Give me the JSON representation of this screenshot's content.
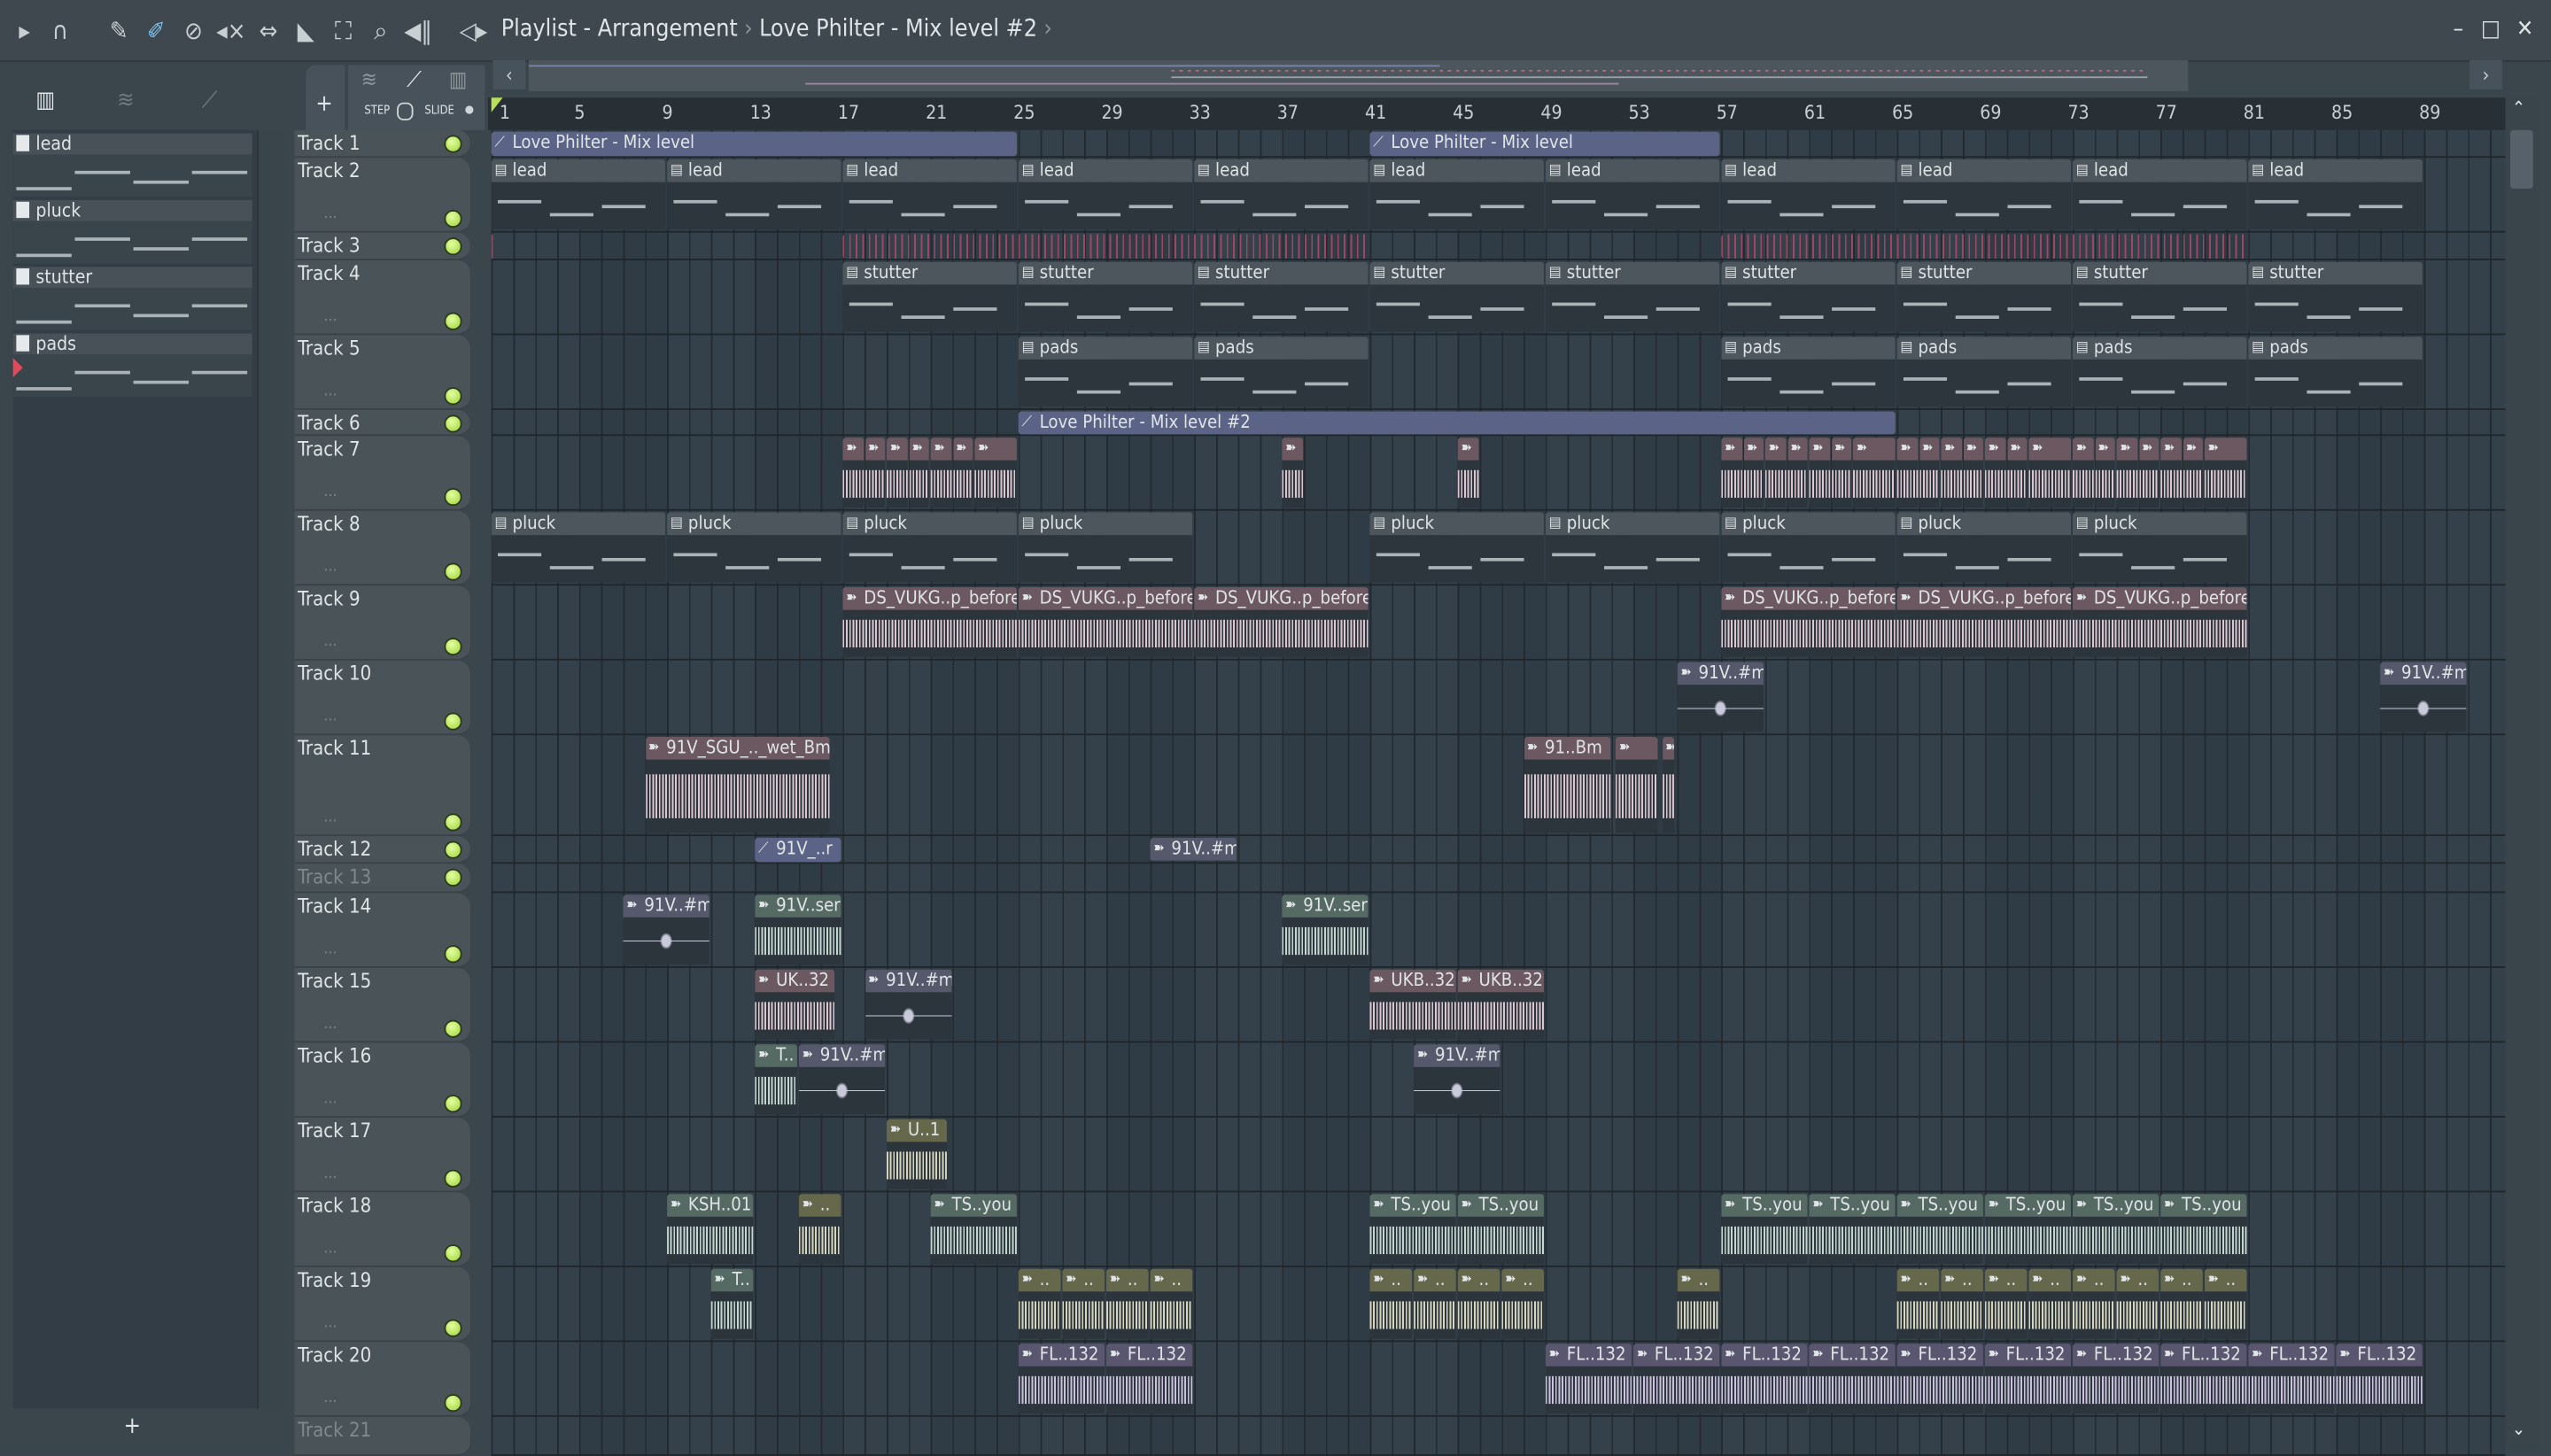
{
  "topbar": {
    "icons": [
      "play-arrow-icon",
      "magnet-icon",
      "pencil-icon",
      "paint-brush-icon",
      "delete-icon",
      "mute-icon",
      "slip-icon",
      "select-icon",
      "zoom-select-icon",
      "zoom-icon",
      "playback-icon",
      "speaker-icon"
    ],
    "breadcrumb": [
      "Playlist - Arrangement",
      "Love Philter - Mix level #2"
    ],
    "window_controls": {
      "minimize": "–",
      "maximize": "□",
      "close": "✕"
    }
  },
  "toolbar2": {
    "add": "+",
    "step": "STEP",
    "slide": "SLIDE"
  },
  "picker": {
    "patterns": [
      "lead",
      "pluck",
      "stutter",
      "pads"
    ],
    "add": "+"
  },
  "ruler": [
    1,
    5,
    9,
    13,
    17,
    21,
    25,
    29,
    33,
    37,
    41,
    45,
    49,
    53,
    57,
    61,
    65,
    69,
    73,
    77,
    81,
    85,
    89
  ],
  "tracks": [
    {
      "name": "Track 1"
    },
    {
      "name": "Track 2"
    },
    {
      "name": "Track 3"
    },
    {
      "name": "Track 4"
    },
    {
      "name": "Track 5"
    },
    {
      "name": "Track 6"
    },
    {
      "name": "Track 7"
    },
    {
      "name": "Track 8"
    },
    {
      "name": "Track 9"
    },
    {
      "name": "Track 10"
    },
    {
      "name": "Track 11"
    },
    {
      "name": "Track 12"
    },
    {
      "name": "Track 13",
      "muted": true
    },
    {
      "name": "Track 14"
    },
    {
      "name": "Track 15"
    },
    {
      "name": "Track 16"
    },
    {
      "name": "Track 17"
    },
    {
      "name": "Track 18"
    },
    {
      "name": "Track 19"
    },
    {
      "name": "Track 20"
    },
    {
      "name": "Track 21",
      "muted": true
    }
  ],
  "clips": [
    {
      "t": 1,
      "s": 1,
      "l": 24,
      "k": "auto",
      "label": "Love Philter - Mix level"
    },
    {
      "t": 1,
      "s": 41,
      "l": 16,
      "k": "auto",
      "label": "Love Philter - Mix level"
    },
    {
      "t": 2,
      "s": 1,
      "l": 8,
      "k": "pattern",
      "label": "lead"
    },
    {
      "t": 2,
      "s": 9,
      "l": 8,
      "k": "pattern",
      "label": "lead"
    },
    {
      "t": 2,
      "s": 17,
      "l": 8,
      "k": "pattern",
      "label": "lead"
    },
    {
      "t": 2,
      "s": 25,
      "l": 8,
      "k": "pattern",
      "label": "lead"
    },
    {
      "t": 2,
      "s": 33,
      "l": 8,
      "k": "pattern",
      "label": "lead"
    },
    {
      "t": 2,
      "s": 41,
      "l": 8,
      "k": "pattern",
      "label": "lead"
    },
    {
      "t": 2,
      "s": 49,
      "l": 8,
      "k": "pattern",
      "label": "lead"
    },
    {
      "t": 2,
      "s": 57,
      "l": 8,
      "k": "pattern",
      "label": "lead"
    },
    {
      "t": 2,
      "s": 65,
      "l": 8,
      "k": "pattern",
      "label": "lead"
    },
    {
      "t": 2,
      "s": 73,
      "l": 8,
      "k": "pattern",
      "label": "lead"
    },
    {
      "t": 2,
      "s": 81,
      "l": 8,
      "k": "pattern",
      "label": "lead"
    },
    {
      "t": 3,
      "s": 1,
      "l": 0.2,
      "k": "lines",
      "label": ""
    },
    {
      "t": 3,
      "s": 17,
      "l": 24,
      "k": "lines",
      "label": ""
    },
    {
      "t": 3,
      "s": 57,
      "l": 24,
      "k": "lines",
      "label": ""
    },
    {
      "t": 4,
      "s": 17,
      "l": 8,
      "k": "pattern",
      "label": "stutter"
    },
    {
      "t": 4,
      "s": 25,
      "l": 8,
      "k": "pattern",
      "label": "stutter"
    },
    {
      "t": 4,
      "s": 33,
      "l": 8,
      "k": "pattern",
      "label": "stutter"
    },
    {
      "t": 4,
      "s": 41,
      "l": 8,
      "k": "pattern",
      "label": "stutter"
    },
    {
      "t": 4,
      "s": 49,
      "l": 8,
      "k": "pattern",
      "label": "stutter"
    },
    {
      "t": 4,
      "s": 57,
      "l": 8,
      "k": "pattern",
      "label": "stutter"
    },
    {
      "t": 4,
      "s": 65,
      "l": 8,
      "k": "pattern",
      "label": "stutter"
    },
    {
      "t": 4,
      "s": 73,
      "l": 8,
      "k": "pattern",
      "label": "stutter"
    },
    {
      "t": 4,
      "s": 81,
      "l": 8,
      "k": "pattern",
      "label": "stutter"
    },
    {
      "t": 5,
      "s": 25,
      "l": 8,
      "k": "pattern",
      "label": "pads"
    },
    {
      "t": 5,
      "s": 33,
      "l": 8,
      "k": "pattern",
      "label": "pads"
    },
    {
      "t": 5,
      "s": 57,
      "l": 8,
      "k": "pattern",
      "label": "pads"
    },
    {
      "t": 5,
      "s": 65,
      "l": 8,
      "k": "pattern",
      "label": "pads"
    },
    {
      "t": 5,
      "s": 73,
      "l": 8,
      "k": "pattern",
      "label": "pads"
    },
    {
      "t": 5,
      "s": 81,
      "l": 8,
      "k": "pattern",
      "label": "pads"
    },
    {
      "t": 6,
      "s": 25,
      "l": 40,
      "k": "auto",
      "label": "Love Philter - Mix level #2"
    },
    {
      "t": 7,
      "s": 17,
      "l": 1,
      "k": "pink",
      "label": ""
    },
    {
      "t": 7,
      "s": 18,
      "l": 1,
      "k": "pink",
      "label": ""
    },
    {
      "t": 7,
      "s": 19,
      "l": 1,
      "k": "pink",
      "label": ""
    },
    {
      "t": 7,
      "s": 20,
      "l": 1,
      "k": "pink",
      "label": ""
    },
    {
      "t": 7,
      "s": 21,
      "l": 1,
      "k": "pink",
      "label": ""
    },
    {
      "t": 7,
      "s": 22,
      "l": 1,
      "k": "pink",
      "label": ""
    },
    {
      "t": 7,
      "s": 23,
      "l": 2,
      "k": "pink",
      "label": ""
    },
    {
      "t": 7,
      "s": 37,
      "l": 1,
      "k": "pink",
      "label": ""
    },
    {
      "t": 7,
      "s": 45,
      "l": 1,
      "k": "pink",
      "label": ""
    },
    {
      "t": 7,
      "s": 57,
      "l": 1,
      "k": "pink",
      "label": ""
    },
    {
      "t": 7,
      "s": 58,
      "l": 1,
      "k": "pink",
      "label": ""
    },
    {
      "t": 7,
      "s": 59,
      "l": 1,
      "k": "pink",
      "label": ""
    },
    {
      "t": 7,
      "s": 60,
      "l": 1,
      "k": "pink",
      "label": ""
    },
    {
      "t": 7,
      "s": 61,
      "l": 1,
      "k": "pink",
      "label": ""
    },
    {
      "t": 7,
      "s": 62,
      "l": 1,
      "k": "pink",
      "label": ""
    },
    {
      "t": 7,
      "s": 63,
      "l": 2,
      "k": "pink",
      "label": ""
    },
    {
      "t": 7,
      "s": 65,
      "l": 1,
      "k": "pink",
      "label": ""
    },
    {
      "t": 7,
      "s": 66,
      "l": 1,
      "k": "pink",
      "label": ""
    },
    {
      "t": 7,
      "s": 67,
      "l": 1,
      "k": "pink",
      "label": ""
    },
    {
      "t": 7,
      "s": 68,
      "l": 1,
      "k": "pink",
      "label": ""
    },
    {
      "t": 7,
      "s": 69,
      "l": 1,
      "k": "pink",
      "label": ""
    },
    {
      "t": 7,
      "s": 70,
      "l": 1,
      "k": "pink",
      "label": ""
    },
    {
      "t": 7,
      "s": 71,
      "l": 2,
      "k": "pink",
      "label": ""
    },
    {
      "t": 7,
      "s": 73,
      "l": 1,
      "k": "pink",
      "label": ""
    },
    {
      "t": 7,
      "s": 74,
      "l": 1,
      "k": "pink",
      "label": ""
    },
    {
      "t": 7,
      "s": 75,
      "l": 1,
      "k": "pink",
      "label": ""
    },
    {
      "t": 7,
      "s": 76,
      "l": 1,
      "k": "pink",
      "label": ""
    },
    {
      "t": 7,
      "s": 77,
      "l": 1,
      "k": "pink",
      "label": ""
    },
    {
      "t": 7,
      "s": 78,
      "l": 1,
      "k": "pink",
      "label": ""
    },
    {
      "t": 7,
      "s": 79,
      "l": 2,
      "k": "pink",
      "label": ""
    },
    {
      "t": 8,
      "s": 1,
      "l": 8,
      "k": "pattern",
      "label": "pluck"
    },
    {
      "t": 8,
      "s": 9,
      "l": 8,
      "k": "pattern",
      "label": "pluck"
    },
    {
      "t": 8,
      "s": 17,
      "l": 8,
      "k": "pattern",
      "label": "pluck"
    },
    {
      "t": 8,
      "s": 25,
      "l": 8,
      "k": "pattern",
      "label": "pluck"
    },
    {
      "t": 8,
      "s": 41,
      "l": 8,
      "k": "pattern",
      "label": "pluck"
    },
    {
      "t": 8,
      "s": 49,
      "l": 8,
      "k": "pattern",
      "label": "pluck"
    },
    {
      "t": 8,
      "s": 57,
      "l": 8,
      "k": "pattern",
      "label": "pluck"
    },
    {
      "t": 8,
      "s": 65,
      "l": 8,
      "k": "pattern",
      "label": "pluck"
    },
    {
      "t": 8,
      "s": 73,
      "l": 8,
      "k": "pattern",
      "label": "pluck"
    },
    {
      "t": 9,
      "s": 17,
      "l": 8,
      "k": "pink",
      "label": "DS_VUKG..p_before"
    },
    {
      "t": 9,
      "s": 25,
      "l": 8,
      "k": "pink",
      "label": "DS_VUKG..p_before"
    },
    {
      "t": 9,
      "s": 33,
      "l": 8,
      "k": "pink",
      "label": "DS_VUKG..p_before"
    },
    {
      "t": 9,
      "s": 57,
      "l": 8,
      "k": "pink",
      "label": "DS_VUKG..p_before"
    },
    {
      "t": 9,
      "s": 65,
      "l": 8,
      "k": "pink",
      "label": "DS_VUKG..p_before"
    },
    {
      "t": 9,
      "s": 73,
      "l": 8,
      "k": "pink",
      "label": "DS_VUKG..p_before"
    },
    {
      "t": 10,
      "s": 55,
      "l": 4,
      "k": "mauve",
      "label": "91V..#m"
    },
    {
      "t": 10,
      "s": 87,
      "l": 4,
      "k": "mauve",
      "label": "91V..#m"
    },
    {
      "t": 11,
      "s": 8,
      "l": 8.5,
      "k": "pink",
      "label": "91V_SGU_.._wet_Bm"
    },
    {
      "t": 11,
      "s": 48,
      "l": 4,
      "k": "pink",
      "label": "91..Bm"
    },
    {
      "t": 11,
      "s": 52.2,
      "l": 2,
      "k": "pink",
      "label": ""
    },
    {
      "t": 11,
      "s": 54.3,
      "l": 0.6,
      "k": "pink",
      "label": ""
    },
    {
      "t": 12,
      "s": 13,
      "l": 4,
      "k": "auto",
      "label": "91V_..r"
    },
    {
      "t": 12,
      "s": 31,
      "l": 4,
      "k": "mauve",
      "label": "91V..#m"
    },
    {
      "t": 14,
      "s": 7,
      "l": 4,
      "k": "mauve",
      "label": "91V..#m"
    },
    {
      "t": 14,
      "s": 13,
      "l": 4,
      "k": "sage",
      "label": "91V..ser"
    },
    {
      "t": 14,
      "s": 37,
      "l": 4,
      "k": "sage",
      "label": "91V..ser"
    },
    {
      "t": 15,
      "s": 13,
      "l": 3.7,
      "k": "pink",
      "label": "UK..32"
    },
    {
      "t": 15,
      "s": 18,
      "l": 4,
      "k": "mauve",
      "label": "91V..#m"
    },
    {
      "t": 15,
      "s": 41,
      "l": 4,
      "k": "pink",
      "label": "UKB..32"
    },
    {
      "t": 15,
      "s": 45,
      "l": 4,
      "k": "pink",
      "label": "UKB..32"
    },
    {
      "t": 16,
      "s": 13,
      "l": 2,
      "k": "sage",
      "label": "T.."
    },
    {
      "t": 16,
      "s": 15,
      "l": 4,
      "k": "mauve",
      "label": "91V..#m"
    },
    {
      "t": 16,
      "s": 43,
      "l": 4,
      "k": "mauve",
      "label": "91V..#m"
    },
    {
      "t": 17,
      "s": 19,
      "l": 2.8,
      "k": "olive",
      "label": "U..1"
    },
    {
      "t": 18,
      "s": 9,
      "l": 4,
      "k": "sage",
      "label": "KSH..01"
    },
    {
      "t": 18,
      "s": 15,
      "l": 2,
      "k": "olive",
      "label": ".."
    },
    {
      "t": 18,
      "s": 21,
      "l": 4,
      "k": "sage",
      "label": "TS..you"
    },
    {
      "t": 18,
      "s": 41,
      "l": 4,
      "k": "sage",
      "label": "TS..you"
    },
    {
      "t": 18,
      "s": 45,
      "l": 4,
      "k": "sage",
      "label": "TS..you"
    },
    {
      "t": 18,
      "s": 57,
      "l": 4,
      "k": "sage",
      "label": "TS..you"
    },
    {
      "t": 18,
      "s": 61,
      "l": 4,
      "k": "sage",
      "label": "TS..you"
    },
    {
      "t": 18,
      "s": 65,
      "l": 4,
      "k": "sage",
      "label": "TS..you"
    },
    {
      "t": 18,
      "s": 69,
      "l": 4,
      "k": "sage",
      "label": "TS..you"
    },
    {
      "t": 18,
      "s": 73,
      "l": 4,
      "k": "sage",
      "label": "TS..you"
    },
    {
      "t": 18,
      "s": 77,
      "l": 4,
      "k": "sage",
      "label": "TS..you"
    },
    {
      "t": 19,
      "s": 11,
      "l": 2,
      "k": "sage",
      "label": "T.."
    },
    {
      "t": 19,
      "s": 25,
      "l": 2,
      "k": "olive",
      "label": ".."
    },
    {
      "t": 19,
      "s": 27,
      "l": 2,
      "k": "olive",
      "label": ".."
    },
    {
      "t": 19,
      "s": 29,
      "l": 2,
      "k": "olive",
      "label": ".."
    },
    {
      "t": 19,
      "s": 31,
      "l": 2,
      "k": "olive",
      "label": ".."
    },
    {
      "t": 19,
      "s": 41,
      "l": 2,
      "k": "olive",
      "label": ".."
    },
    {
      "t": 19,
      "s": 43,
      "l": 2,
      "k": "olive",
      "label": ".."
    },
    {
      "t": 19,
      "s": 45,
      "l": 2,
      "k": "olive",
      "label": ".."
    },
    {
      "t": 19,
      "s": 47,
      "l": 2,
      "k": "olive",
      "label": ".."
    },
    {
      "t": 19,
      "s": 55,
      "l": 2,
      "k": "olive",
      "label": ".."
    },
    {
      "t": 19,
      "s": 65,
      "l": 2,
      "k": "olive",
      "label": ".."
    },
    {
      "t": 19,
      "s": 67,
      "l": 2,
      "k": "olive",
      "label": ".."
    },
    {
      "t": 19,
      "s": 69,
      "l": 2,
      "k": "olive",
      "label": ".."
    },
    {
      "t": 19,
      "s": 71,
      "l": 2,
      "k": "olive",
      "label": ".."
    },
    {
      "t": 19,
      "s": 73,
      "l": 2,
      "k": "olive",
      "label": ".."
    },
    {
      "t": 19,
      "s": 75,
      "l": 2,
      "k": "olive",
      "label": ".."
    },
    {
      "t": 19,
      "s": 77,
      "l": 2,
      "k": "olive",
      "label": ".."
    },
    {
      "t": 19,
      "s": 79,
      "l": 2,
      "k": "olive",
      "label": ".."
    },
    {
      "t": 20,
      "s": 25,
      "l": 4,
      "k": "violet",
      "label": "FL..132"
    },
    {
      "t": 20,
      "s": 29,
      "l": 4,
      "k": "violet",
      "label": "FL..132"
    },
    {
      "t": 20,
      "s": 49,
      "l": 4,
      "k": "violet",
      "label": "FL..132"
    },
    {
      "t": 20,
      "s": 53,
      "l": 4,
      "k": "violet",
      "label": "FL..132"
    },
    {
      "t": 20,
      "s": 57,
      "l": 4,
      "k": "violet",
      "label": "FL..132"
    },
    {
      "t": 20,
      "s": 61,
      "l": 4,
      "k": "violet",
      "label": "FL..132"
    },
    {
      "t": 20,
      "s": 65,
      "l": 4,
      "k": "violet",
      "label": "FL..132"
    },
    {
      "t": 20,
      "s": 69,
      "l": 4,
      "k": "violet",
      "label": "FL..132"
    },
    {
      "t": 20,
      "s": 73,
      "l": 4,
      "k": "violet",
      "label": "FL..132"
    },
    {
      "t": 20,
      "s": 77,
      "l": 4,
      "k": "violet",
      "label": "FL..132"
    },
    {
      "t": 20,
      "s": 81,
      "l": 4,
      "k": "violet",
      "label": "FL..132"
    },
    {
      "t": 20,
      "s": 85,
      "l": 4,
      "k": "violet",
      "label": "FL..132"
    }
  ]
}
